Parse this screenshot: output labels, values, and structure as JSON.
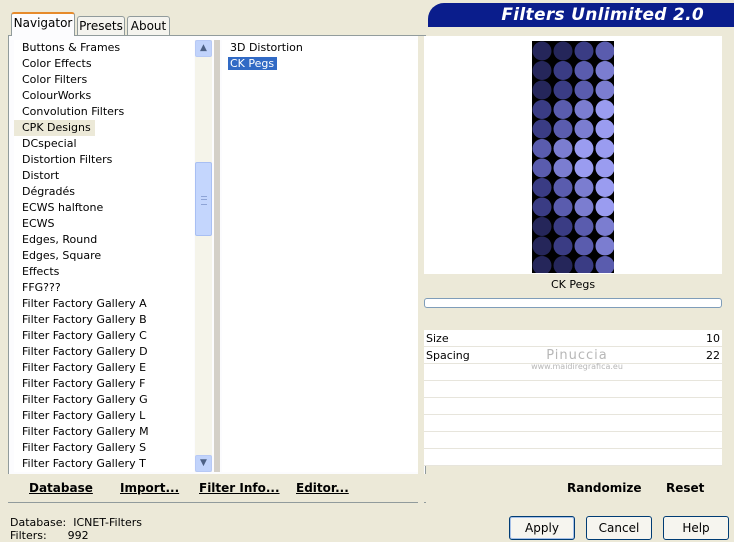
{
  "tabs": [
    {
      "label": "Navigator",
      "active": true
    },
    {
      "label": "Presets",
      "active": false
    },
    {
      "label": "About",
      "active": false
    }
  ],
  "title": "Filters Unlimited 2.0",
  "categories": [
    "Buttons & Frames",
    "Color Effects",
    "Color Filters",
    "ColourWorks",
    "Convolution Filters",
    "CPK Designs",
    "DCspecial",
    "Distortion Filters",
    "Distort",
    "Dégradés",
    "ECWS halftone",
    "ECWS",
    "Edges, Round",
    "Edges, Square",
    "Effects",
    "FFG???",
    "Filter Factory Gallery A",
    "Filter Factory Gallery B",
    "Filter Factory Gallery C",
    "Filter Factory Gallery D",
    "Filter Factory Gallery E",
    "Filter Factory Gallery F",
    "Filter Factory Gallery G",
    "Filter Factory Gallery L",
    "Filter Factory Gallery M",
    "Filter Factory Gallery S",
    "Filter Factory Gallery T"
  ],
  "selected_category": "CPK Designs",
  "filters": [
    "3D Distortion",
    "CK Pegs"
  ],
  "selected_filter": "CK Pegs",
  "preview": {
    "caption": "CK Pegs",
    "colors": [
      "#25265a",
      "#3a3c84",
      "#5a5cae",
      "#7b7dd0",
      "#9a9cf0",
      "#b5b6f4"
    ]
  },
  "params": [
    {
      "label": "Size",
      "value": "10"
    },
    {
      "label": "Spacing",
      "value": "22"
    }
  ],
  "watermark": {
    "line1": "Pinuccia",
    "line2": "www.maidiregrafica.eu"
  },
  "bottom_links": {
    "database": "Database",
    "import": "Import...",
    "filter_info": "Filter Info...",
    "editor": "Editor...",
    "randomize": "Randomize",
    "reset": "Reset"
  },
  "status": {
    "database_label": "Database:",
    "database_value": "ICNET-Filters",
    "filters_label": "Filters:",
    "filters_value": "992"
  },
  "buttons": {
    "apply": "Apply",
    "cancel": "Cancel",
    "help": "Help"
  },
  "icons": {
    "scroll_up": "chevron-up-icon",
    "scroll_down": "chevron-down-icon",
    "scroll_grip": "grip-icon"
  }
}
